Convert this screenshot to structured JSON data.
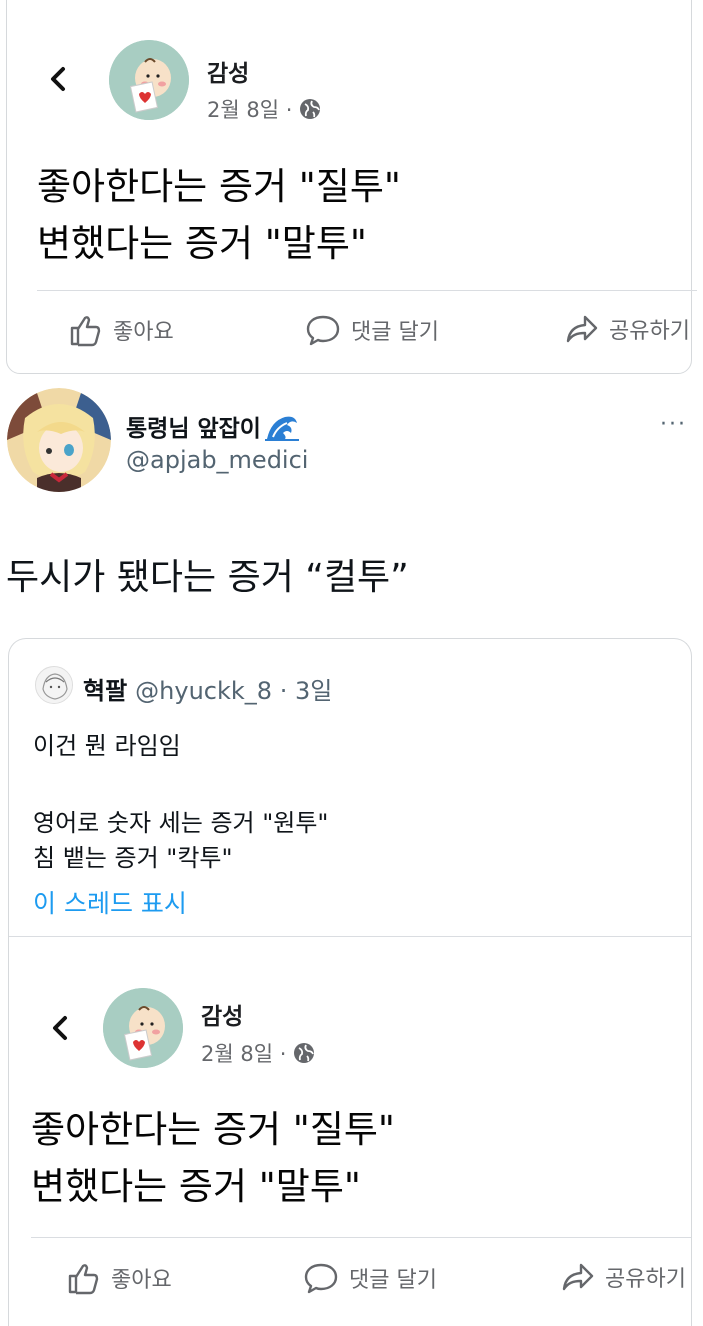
{
  "top_post": {
    "author": "감성",
    "date": "2월 8일 ·",
    "body_lines": [
      "좋아한다는 증거 \"질투\"",
      "변했다는 증거 \"말투\""
    ],
    "actions": {
      "like": "좋아요",
      "comment": "댓글 달기",
      "share": "공유하기"
    }
  },
  "tweet": {
    "display_name": "통령님 앞잡이",
    "handle": "@apjab_medici",
    "text": "두시가 됐다는 증거 “컬투”",
    "more_label": "···"
  },
  "quoted": {
    "display_name": "혁팔",
    "handle_time": "@hyuckk_8 · 3일",
    "line1": "이건 뭔 라임임",
    "line2": "영어로 숫자 세는 증거 \"원투\"",
    "line3": "침 뱉는 증거 \"칵투\"",
    "thread_link": "이 스레드 표시",
    "embedded_post": {
      "author": "감성",
      "date": "2월 8일 ·",
      "body_lines": [
        "좋아한다는 증거 \"질투\"",
        "변했다는 증거 \"말투\""
      ],
      "actions": {
        "like": "좋아요",
        "comment": "댓글 달기",
        "share": "공유하기"
      }
    }
  },
  "colors": {
    "link_blue": "#1d9bf0",
    "fb_gray": "#65676b",
    "avatar_teal": "#a8cdc2"
  },
  "icons": [
    "back-arrow-icon",
    "globe-icon",
    "thumbs-up-icon",
    "comment-icon",
    "share-icon",
    "wave-emoji-icon",
    "more-icon"
  ]
}
